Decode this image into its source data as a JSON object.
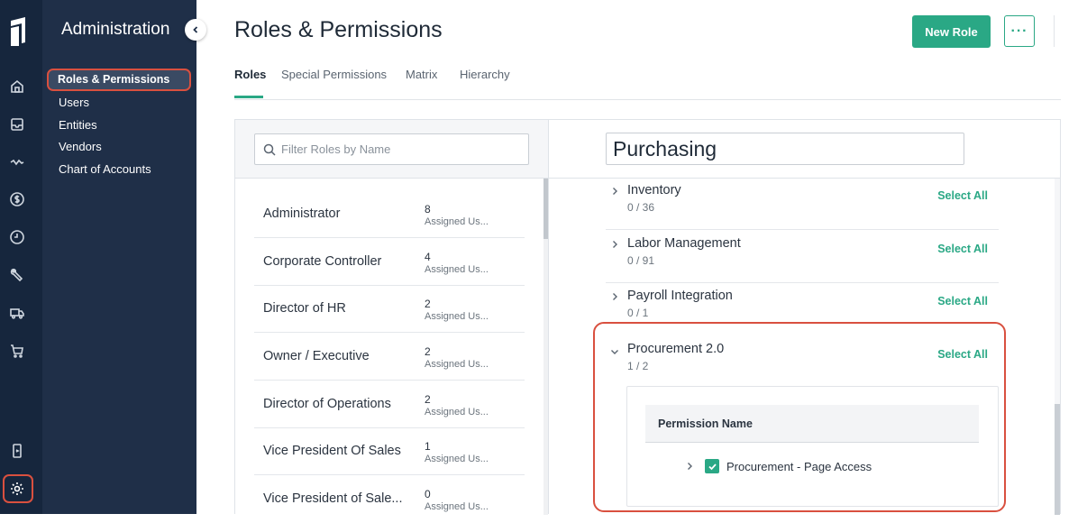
{
  "colors": {
    "accent": "#2aa885",
    "highlight": "#d9503f",
    "rail": "#16263d",
    "nav": "#1f2f48"
  },
  "rail": {
    "icons": [
      "home-icon",
      "inbox-icon",
      "activity-icon",
      "dollar-icon",
      "clock-icon",
      "wrench-icon",
      "truck-icon",
      "cart-icon",
      "mobile-icon",
      "gear-icon"
    ]
  },
  "nav": {
    "title": "Administration",
    "items": [
      {
        "label": "Roles & Permissions",
        "active": true
      },
      {
        "label": "Users"
      },
      {
        "label": "Entities"
      },
      {
        "label": "Vendors"
      },
      {
        "label": "Chart of Accounts"
      }
    ]
  },
  "header": {
    "title": "Roles & Permissions",
    "new_role_label": "New Role",
    "more_label": "···"
  },
  "tabs": [
    {
      "label": "Roles",
      "active": true
    },
    {
      "label": "Special Permissions"
    },
    {
      "label": "Matrix"
    },
    {
      "label": "Hierarchy"
    }
  ],
  "roles_panel": {
    "search_placeholder": "Filter Roles by Name",
    "roles": [
      {
        "name": "Administrator",
        "count": "8",
        "sub": "Assigned Us..."
      },
      {
        "name": "Corporate Controller",
        "count": "4",
        "sub": "Assigned Us..."
      },
      {
        "name": "Director of HR",
        "count": "2",
        "sub": "Assigned Us..."
      },
      {
        "name": "Owner / Executive",
        "count": "2",
        "sub": "Assigned Us..."
      },
      {
        "name": "Director of Operations",
        "count": "2",
        "sub": "Assigned Us..."
      },
      {
        "name": "Vice President Of Sales",
        "count": "1",
        "sub": "Assigned Us..."
      },
      {
        "name": "Vice President of Sale...",
        "count": "0",
        "sub": "Assigned Us..."
      }
    ]
  },
  "role_detail": {
    "role_name": "Purchasing",
    "select_all_label": "Select All",
    "groups": [
      {
        "name": "Inventory",
        "count": "0 / 36",
        "expanded": false
      },
      {
        "name": "Labor Management",
        "count": "0 / 91",
        "expanded": false
      },
      {
        "name": "Payroll Integration",
        "count": "0 / 1",
        "expanded": false
      },
      {
        "name": "Procurement 2.0",
        "count": "1 / 2",
        "expanded": true
      }
    ],
    "table_header": "Permission Name",
    "permissions": [
      {
        "label": "Procurement - Page Access",
        "checked": true
      }
    ]
  }
}
